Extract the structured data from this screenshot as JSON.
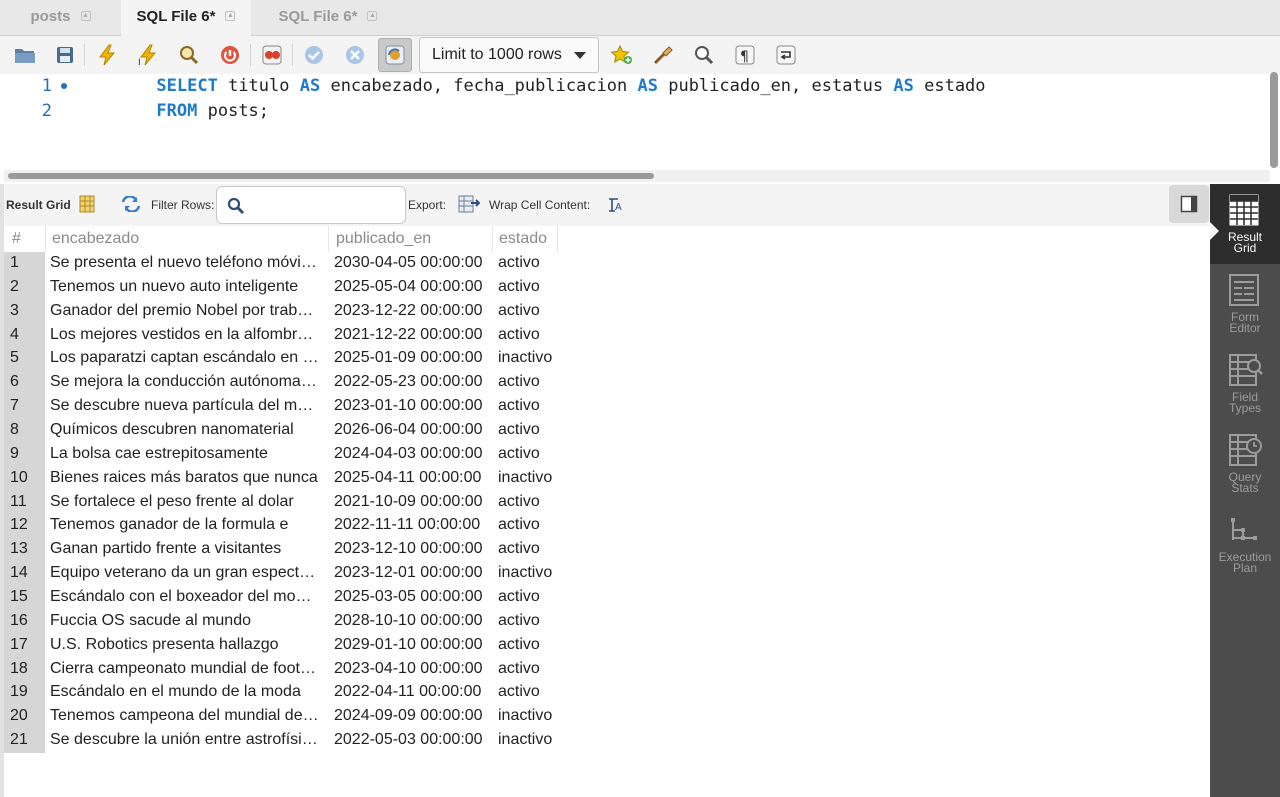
{
  "tabs": [
    {
      "label": "posts",
      "active": false
    },
    {
      "label": "SQL File 6*",
      "active": true
    },
    {
      "label": "SQL File 6*",
      "active": false
    }
  ],
  "toolbar": {
    "limit_select": "Limit to 1000 rows",
    "icons": [
      "open-folder-icon",
      "save-icon",
      "execute-icon",
      "execute-current-icon",
      "explain-icon",
      "stop-icon",
      "toggle-error-icon",
      "commit-icon",
      "rollback-icon",
      "autocommit-icon",
      "bookmark-icon",
      "beautify-icon",
      "find-icon",
      "invisible-chars-icon",
      "wrap-icon"
    ]
  },
  "editor": {
    "lines": [
      {
        "num": "1",
        "parts": [
          {
            "t": "SELECT",
            "kw": true
          },
          {
            "t": " titulo ",
            "kw": false
          },
          {
            "t": "AS",
            "kw": true
          },
          {
            "t": " encabezado, fecha_publicacion ",
            "kw": false
          },
          {
            "t": "AS",
            "kw": true
          },
          {
            "t": " publicado_en, estatus ",
            "kw": false
          },
          {
            "t": "AS",
            "kw": true
          },
          {
            "t": " estado",
            "kw": false
          }
        ]
      },
      {
        "num": "2",
        "parts": [
          {
            "t": "FROM",
            "kw": true
          },
          {
            "t": " posts;",
            "kw": false
          }
        ]
      }
    ]
  },
  "result_toolbar": {
    "result_grid_label": "Result Grid",
    "filter_label": "Filter Rows:",
    "filter_value": "",
    "export_label": "Export:",
    "wrap_label": "Wrap Cell Content:"
  },
  "grid": {
    "columns": [
      "#",
      "encabezado",
      "publicado_en",
      "estado"
    ],
    "rows": [
      [
        "1",
        "Se presenta el nuevo teléfono móvi…",
        "2030-04-05 00:00:00",
        "activo"
      ],
      [
        "2",
        "Tenemos un nuevo auto inteligente",
        "2025-05-04 00:00:00",
        "activo"
      ],
      [
        "3",
        "Ganador del premio Nobel por trab…",
        "2023-12-22 00:00:00",
        "activo"
      ],
      [
        "4",
        "Los mejores vestidos en la alfombr…",
        "2021-12-22 00:00:00",
        "activo"
      ],
      [
        "5",
        "Los paparatzi captan escándalo en …",
        "2025-01-09 00:00:00",
        "inactivo"
      ],
      [
        "6",
        "Se mejora la conducción autónoma…",
        "2022-05-23 00:00:00",
        "activo"
      ],
      [
        "7",
        "Se descubre nueva partícula del m…",
        "2023-01-10 00:00:00",
        "activo"
      ],
      [
        "8",
        "Químicos descubren nanomaterial",
        "2026-06-04 00:00:00",
        "activo"
      ],
      [
        "9",
        "La bolsa cae estrepitosamente",
        "2024-04-03 00:00:00",
        "activo"
      ],
      [
        "10",
        "Bienes raices más baratos que nunca",
        "2025-04-11 00:00:00",
        "inactivo"
      ],
      [
        "11",
        "Se fortalece el peso frente al dolar",
        "2021-10-09 00:00:00",
        "activo"
      ],
      [
        "12",
        "Tenemos ganador de la formula e",
        "2022-11-11 00:00:00",
        "activo"
      ],
      [
        "13",
        "Ganan partido frente a visitantes",
        "2023-12-10 00:00:00",
        "activo"
      ],
      [
        "14",
        "Equipo veterano da un gran espect…",
        "2023-12-01 00:00:00",
        "inactivo"
      ],
      [
        "15",
        "Escándalo con el boxeador del mo…",
        "2025-03-05 00:00:00",
        "activo"
      ],
      [
        "16",
        "Fuccia OS sacude al mundo",
        "2028-10-10 00:00:00",
        "activo"
      ],
      [
        "17",
        "U.S. Robotics presenta hallazgo",
        "2029-01-10 00:00:00",
        "activo"
      ],
      [
        "18",
        "Cierra campeonato mundial de foot…",
        "2023-04-10 00:00:00",
        "activo"
      ],
      [
        "19",
        "Escándalo en el mundo de la moda",
        "2022-04-11 00:00:00",
        "activo"
      ],
      [
        "20",
        "Tenemos campeona del mundial de…",
        "2024-09-09 00:00:00",
        "inactivo"
      ],
      [
        "21",
        "Se descubre la unión entre astrofísi…",
        "2022-05-03 00:00:00",
        "inactivo"
      ]
    ]
  },
  "side_panel": [
    {
      "line1": "Result",
      "line2": "Grid",
      "active": true
    },
    {
      "line1": "Form",
      "line2": "Editor",
      "active": false
    },
    {
      "line1": "Field",
      "line2": "Types",
      "active": false
    },
    {
      "line1": "Query",
      "line2": "Stats",
      "active": false
    },
    {
      "line1": "Execution",
      "line2": "Plan",
      "active": false
    }
  ],
  "colors": {
    "keyword": "#1d7bc9",
    "line_number": "#1f6fbf",
    "side_panel": "#4c4c4c",
    "side_active": "#2d2d2d"
  }
}
